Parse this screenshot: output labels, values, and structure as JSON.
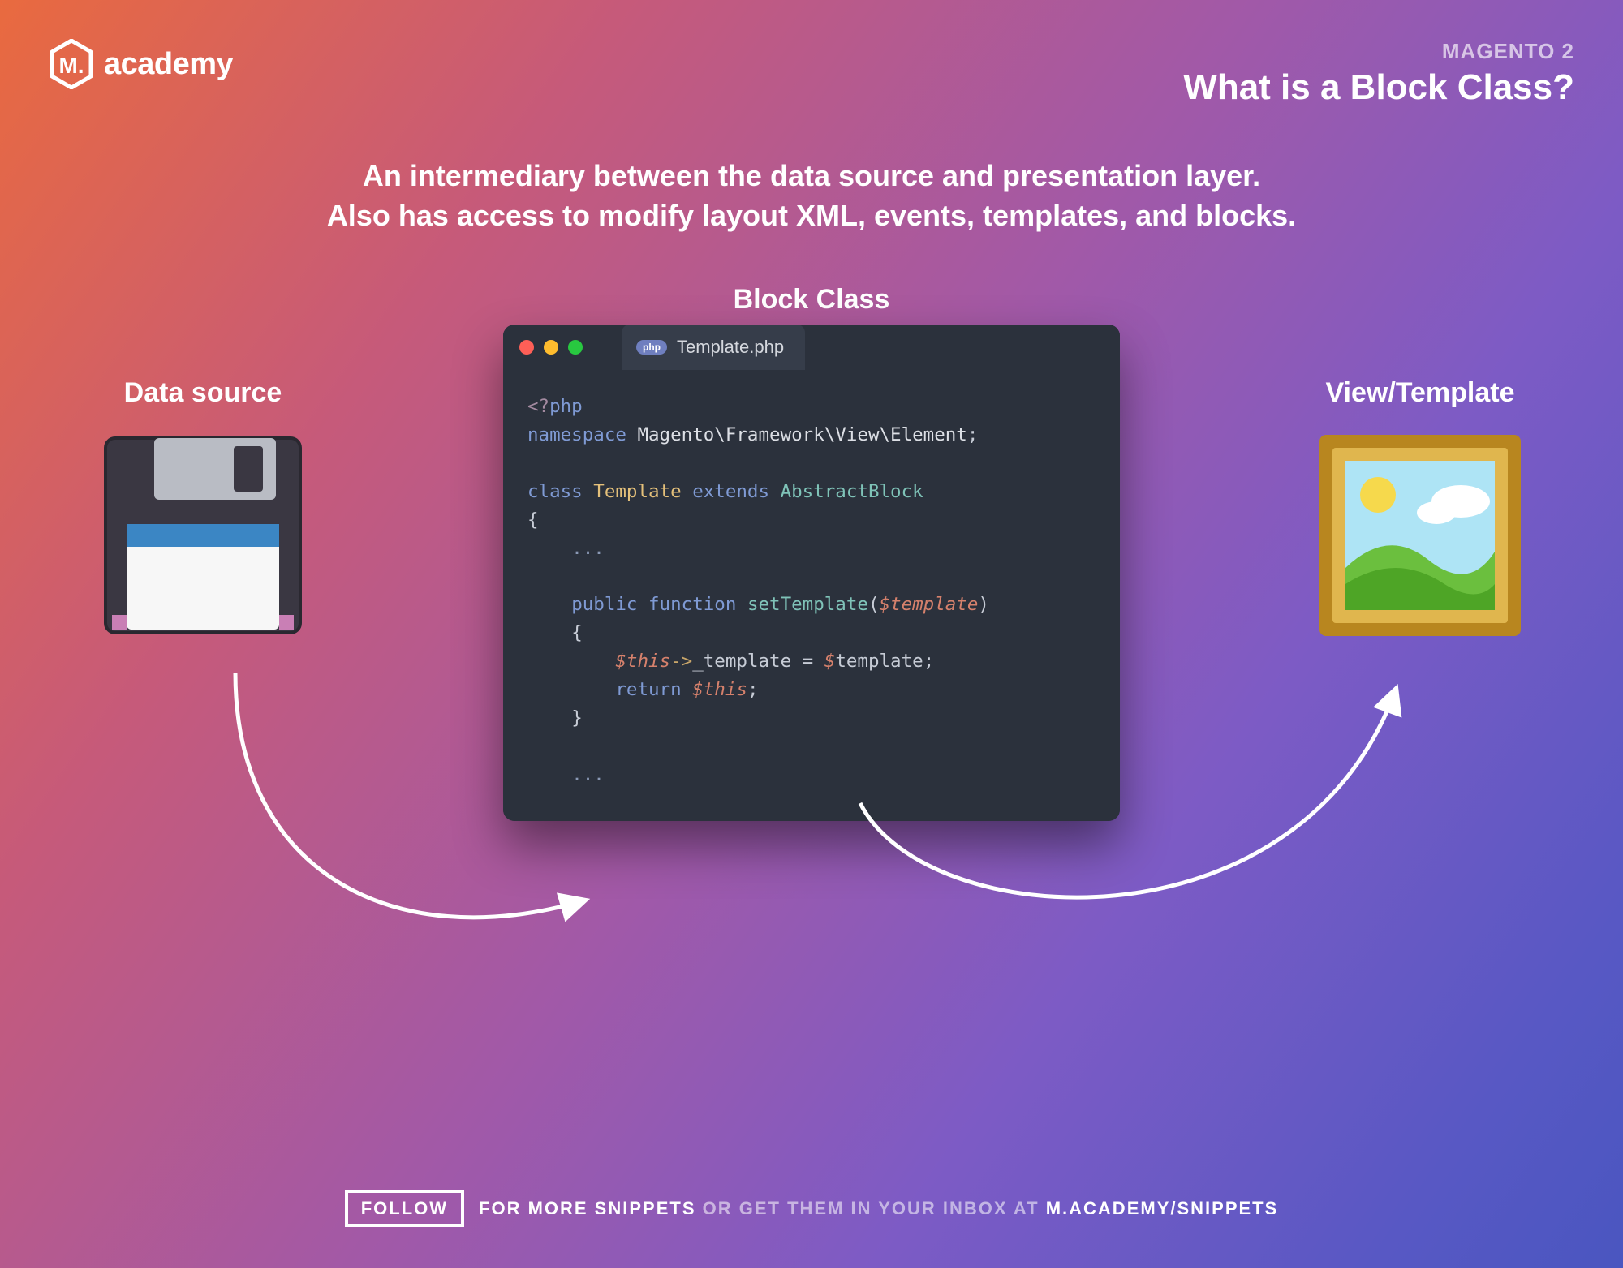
{
  "header": {
    "logo_text": "academy",
    "kicker": "MAGENTO 2",
    "title": "What is a Block Class?"
  },
  "intro": {
    "line1": "An intermediary between the data source and presentation layer.",
    "line2": "Also has access to modify layout XML, events, templates, and blocks."
  },
  "labels": {
    "data_source": "Data source",
    "block_class": "Block Class",
    "view_template": "View/Template"
  },
  "editor": {
    "tab_filename": "Template.php",
    "tab_lang_pill": "php"
  },
  "code": {
    "l1_open": "<?",
    "l1_php": "php",
    "l2_kw": "namespace",
    "l2_ns": "Magento\\Framework\\View\\Element",
    "l2_end": ";",
    "l4_kw": "class",
    "l4_name": "Template",
    "l4_ext": "extends",
    "l4_parent": "AbstractBlock",
    "l5_brace": "{",
    "l6_dots": "...",
    "l8_vis": "public",
    "l8_fn": "function",
    "l8_name": "setTemplate",
    "l8_par_open": "(",
    "l8_param_sig": "$",
    "l8_param": "template",
    "l8_par_close": ")",
    "l9_brace": "{",
    "l10_this_sig": "$",
    "l10_this": "this",
    "l10_arrow": "->",
    "l10_prop": "_template",
    "l10_eq": " = ",
    "l10_rhs_sig": "$",
    "l10_rhs": "template",
    "l10_end": ";",
    "l11_return": "return",
    "l11_this_sig": "$",
    "l11_this": "this",
    "l11_end": ";",
    "l12_brace": "}",
    "l14_dots": "..."
  },
  "footer": {
    "follow": "FOLLOW",
    "part1": "FOR MORE SNIPPETS",
    "part2": "OR GET THEM IN YOUR INBOX AT",
    "link": "M.ACADEMY/SNIPPETS"
  }
}
